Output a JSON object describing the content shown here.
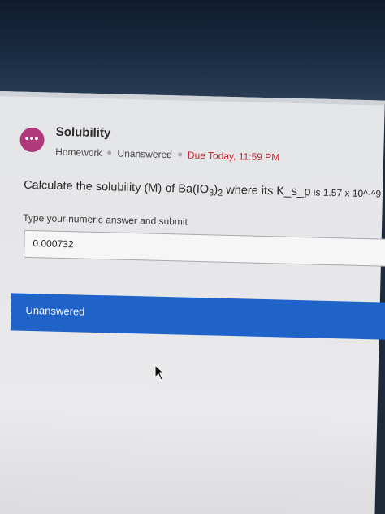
{
  "assignment": {
    "badge_icon": "•••",
    "title": "Solubility",
    "type": "Homework",
    "state": "Unanswered",
    "due": "Due Today, 11:59 PM"
  },
  "question": {
    "prefix": "Calculate the solubility (M) of Ba(IO",
    "sub1": "3",
    "close": ")",
    "sub2": "2",
    "middle": " where its K",
    "ksp": "_s_p",
    "suffix": " is 1.57 x 10^-^9"
  },
  "answer": {
    "prompt": "Type your numeric answer and submit",
    "value": "0.000732"
  },
  "status_bar": {
    "label": "Unanswered",
    "color": "#1f63c9"
  },
  "colors": {
    "badge": "#b2387c",
    "due": "#c8282e"
  }
}
